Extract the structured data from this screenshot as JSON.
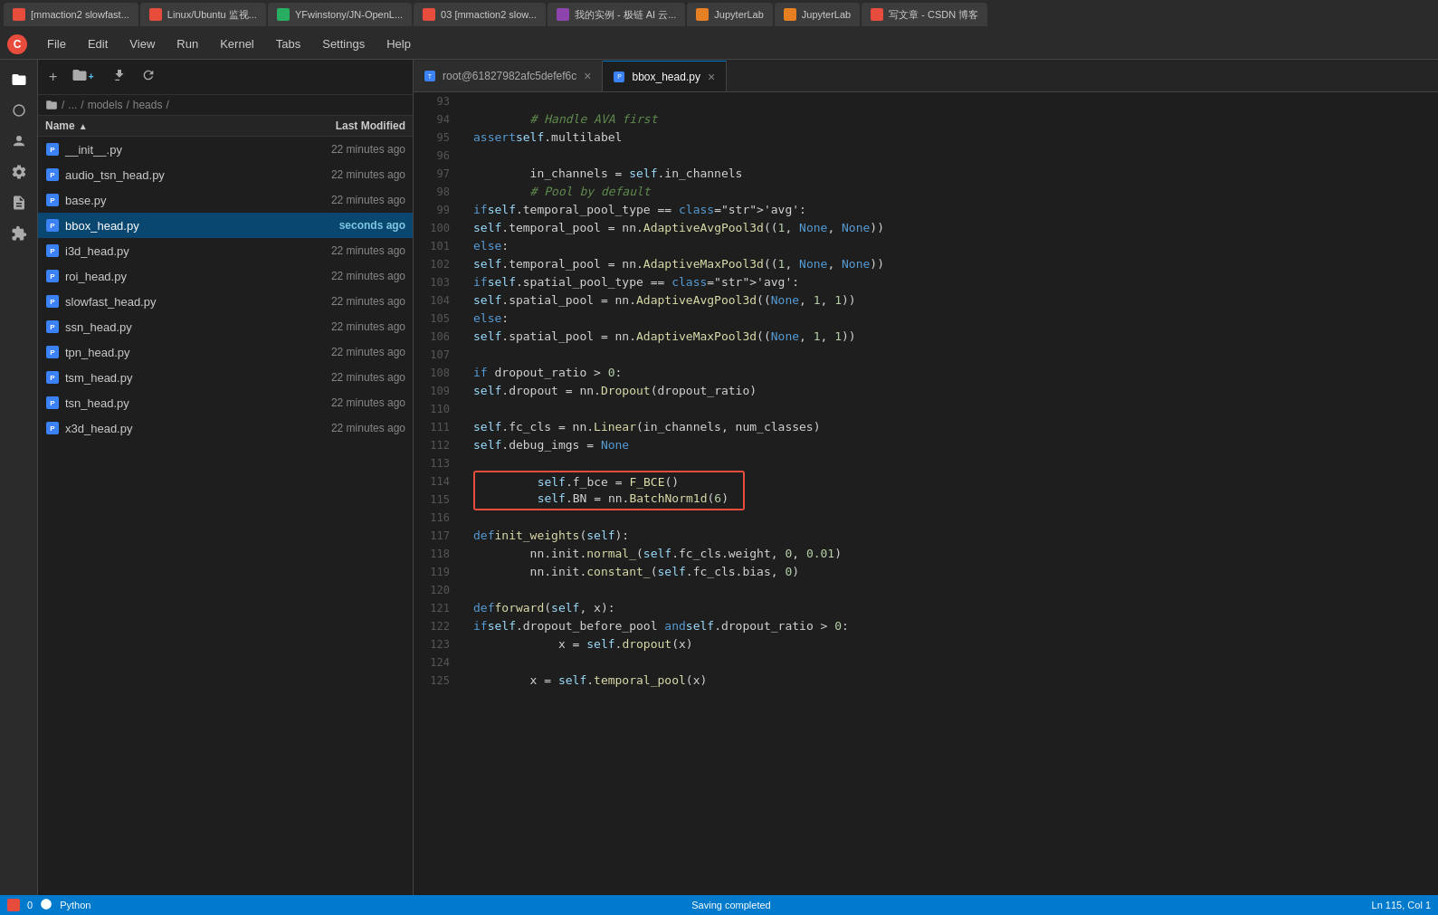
{
  "browserTabs": [
    {
      "label": "[mmaction2 slowfast...",
      "color": "red",
      "active": false
    },
    {
      "label": "Linux/Ubuntu 监视...",
      "color": "red",
      "active": false
    },
    {
      "label": "YFwinstony/JN-OpenL...",
      "color": "green",
      "active": false
    },
    {
      "label": "03 [mmaction2 slow...",
      "color": "red",
      "active": false
    },
    {
      "label": "我的实例 - 极链 AI 云...",
      "color": "purple",
      "active": false
    },
    {
      "label": "JupyterLab",
      "color": "orange",
      "active": false
    },
    {
      "label": "JupyterLab",
      "color": "orange",
      "active": false
    },
    {
      "label": "写文章 - CSDN 博客",
      "color": "red",
      "active": false
    }
  ],
  "menuItems": [
    "File",
    "Edit",
    "View",
    "Run",
    "Kernel",
    "Tabs",
    "Settings",
    "Help"
  ],
  "sidebarIcons": [
    {
      "name": "folder-icon",
      "symbol": "📁",
      "active": true
    },
    {
      "name": "circle-icon",
      "symbol": "⬤"
    },
    {
      "name": "users-icon",
      "symbol": "👤"
    },
    {
      "name": "gear-icon",
      "symbol": "⚙"
    },
    {
      "name": "file-icon",
      "symbol": "📄"
    },
    {
      "name": "puzzle-icon",
      "symbol": "🧩"
    }
  ],
  "breadcrumb": {
    "items": [
      "📁",
      "/",
      "...",
      "/",
      "models",
      "/",
      "heads",
      "/"
    ]
  },
  "fileListHeader": {
    "nameLabel": "Name",
    "modifiedLabel": "Last Modified"
  },
  "files": [
    {
      "name": "__init__.py",
      "modified": "22 minutes ago",
      "selected": false
    },
    {
      "name": "audio_tsn_head.py",
      "modified": "22 minutes ago",
      "selected": false
    },
    {
      "name": "base.py",
      "modified": "22 minutes ago",
      "selected": false
    },
    {
      "name": "bbox_head.py",
      "modified": "seconds ago",
      "selected": true
    },
    {
      "name": "i3d_head.py",
      "modified": "22 minutes ago",
      "selected": false
    },
    {
      "name": "roi_head.py",
      "modified": "22 minutes ago",
      "selected": false
    },
    {
      "name": "slowfast_head.py",
      "modified": "22 minutes ago",
      "selected": false
    },
    {
      "name": "ssn_head.py",
      "modified": "22 minutes ago",
      "selected": false
    },
    {
      "name": "tpn_head.py",
      "modified": "22 minutes ago",
      "selected": false
    },
    {
      "name": "tsm_head.py",
      "modified": "22 minutes ago",
      "selected": false
    },
    {
      "name": "tsn_head.py",
      "modified": "22 minutes ago",
      "selected": false
    },
    {
      "name": "x3d_head.py",
      "modified": "22 minutes ago",
      "selected": false
    }
  ],
  "editorTabs": [
    {
      "label": "root@61827982afc5defef6c",
      "active": false,
      "closable": true
    },
    {
      "label": "bbox_head.py",
      "active": true,
      "closable": true
    }
  ],
  "codeLines": [
    {
      "num": 93,
      "content": ""
    },
    {
      "num": 94,
      "content": "        # Handle AVA first"
    },
    {
      "num": 95,
      "content": "        assert self.multilabel"
    },
    {
      "num": 96,
      "content": ""
    },
    {
      "num": 97,
      "content": "        in_channels = self.in_channels"
    },
    {
      "num": 98,
      "content": "        # Pool by default"
    },
    {
      "num": 99,
      "content": "        if self.temporal_pool_type == 'avg':"
    },
    {
      "num": 100,
      "content": "            self.temporal_pool = nn.AdaptiveAvgPool3d((1, None, None))"
    },
    {
      "num": 101,
      "content": "        else:"
    },
    {
      "num": 102,
      "content": "            self.temporal_pool = nn.AdaptiveMaxPool3d((1, None, None))"
    },
    {
      "num": 103,
      "content": "        if self.spatial_pool_type == 'avg':"
    },
    {
      "num": 104,
      "content": "            self.spatial_pool = nn.AdaptiveAvgPool3d((None, 1, 1))"
    },
    {
      "num": 105,
      "content": "        else:"
    },
    {
      "num": 106,
      "content": "            self.spatial_pool = nn.AdaptiveMaxPool3d((None, 1, 1))"
    },
    {
      "num": 107,
      "content": ""
    },
    {
      "num": 108,
      "content": "        if dropout_ratio > 0:"
    },
    {
      "num": 109,
      "content": "            self.dropout = nn.Dropout(dropout_ratio)"
    },
    {
      "num": 110,
      "content": ""
    },
    {
      "num": 111,
      "content": "        self.fc_cls = nn.Linear(in_channels, num_classes)"
    },
    {
      "num": 112,
      "content": "        self.debug_imgs = None"
    },
    {
      "num": 113,
      "content": ""
    },
    {
      "num": 114,
      "content": "        self.f_bce = F_BCE()",
      "highlighted": true
    },
    {
      "num": 115,
      "content": "        self.BN = nn.BatchNorm1d(6)",
      "highlighted": true
    },
    {
      "num": 116,
      "content": ""
    },
    {
      "num": 117,
      "content": "    def init_weights(self):"
    },
    {
      "num": 118,
      "content": "        nn.init.normal_(self.fc_cls.weight, 0, 0.01)"
    },
    {
      "num": 119,
      "content": "        nn.init.constant_(self.fc_cls.bias, 0)"
    },
    {
      "num": 120,
      "content": ""
    },
    {
      "num": 121,
      "content": "    def forward(self, x):"
    },
    {
      "num": 122,
      "content": "        if self.dropout_before_pool and self.dropout_ratio > 0:"
    },
    {
      "num": 123,
      "content": "            x = self.dropout(x)"
    },
    {
      "num": 124,
      "content": ""
    },
    {
      "num": 125,
      "content": "        x = self.temporal_pool(x)"
    }
  ],
  "statusBar": {
    "left": [
      "0",
      "Python"
    ],
    "center": "Saving completed",
    "right": "Ln 115, Col 1"
  }
}
